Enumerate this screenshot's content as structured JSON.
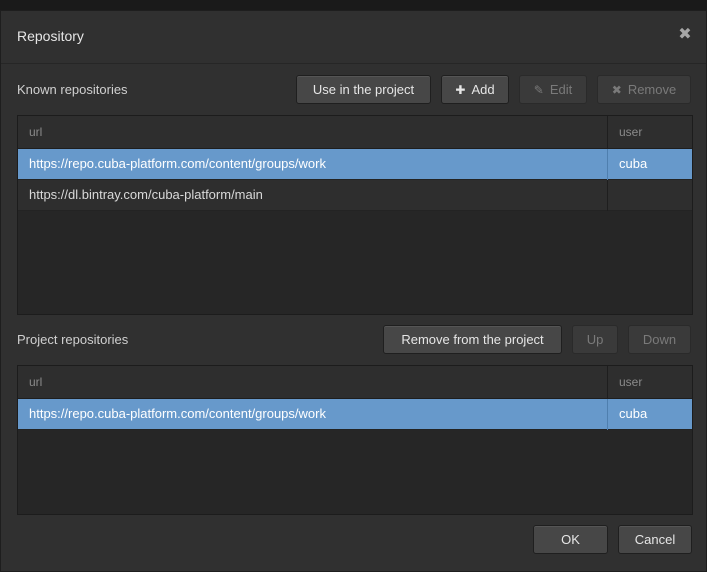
{
  "dialog": {
    "title": "Repository",
    "close_glyph": "✖"
  },
  "known": {
    "label": "Known repositories",
    "buttons": {
      "use": "Use in the project",
      "add": "Add",
      "edit": "Edit",
      "remove": "Remove"
    },
    "columns": {
      "url": "url",
      "user": "user"
    },
    "rows": [
      {
        "url": "https://repo.cuba-platform.com/content/groups/work",
        "user": "cuba",
        "selected": true
      },
      {
        "url": "https://dl.bintray.com/cuba-platform/main",
        "user": "",
        "selected": false
      }
    ]
  },
  "project": {
    "label": "Project repositories",
    "buttons": {
      "remove_from_project": "Remove from the project",
      "up": "Up",
      "down": "Down"
    },
    "columns": {
      "url": "url",
      "user": "user"
    },
    "rows": [
      {
        "url": "https://repo.cuba-platform.com/content/groups/work",
        "user": "cuba",
        "selected": true
      }
    ]
  },
  "footer": {
    "ok": "OK",
    "cancel": "Cancel"
  },
  "colors": {
    "selection": "#6799cb",
    "background": "#303030"
  },
  "icons": {
    "add": "plus-icon",
    "edit": "pencil-icon",
    "remove": "x-icon",
    "close": "close-icon"
  }
}
